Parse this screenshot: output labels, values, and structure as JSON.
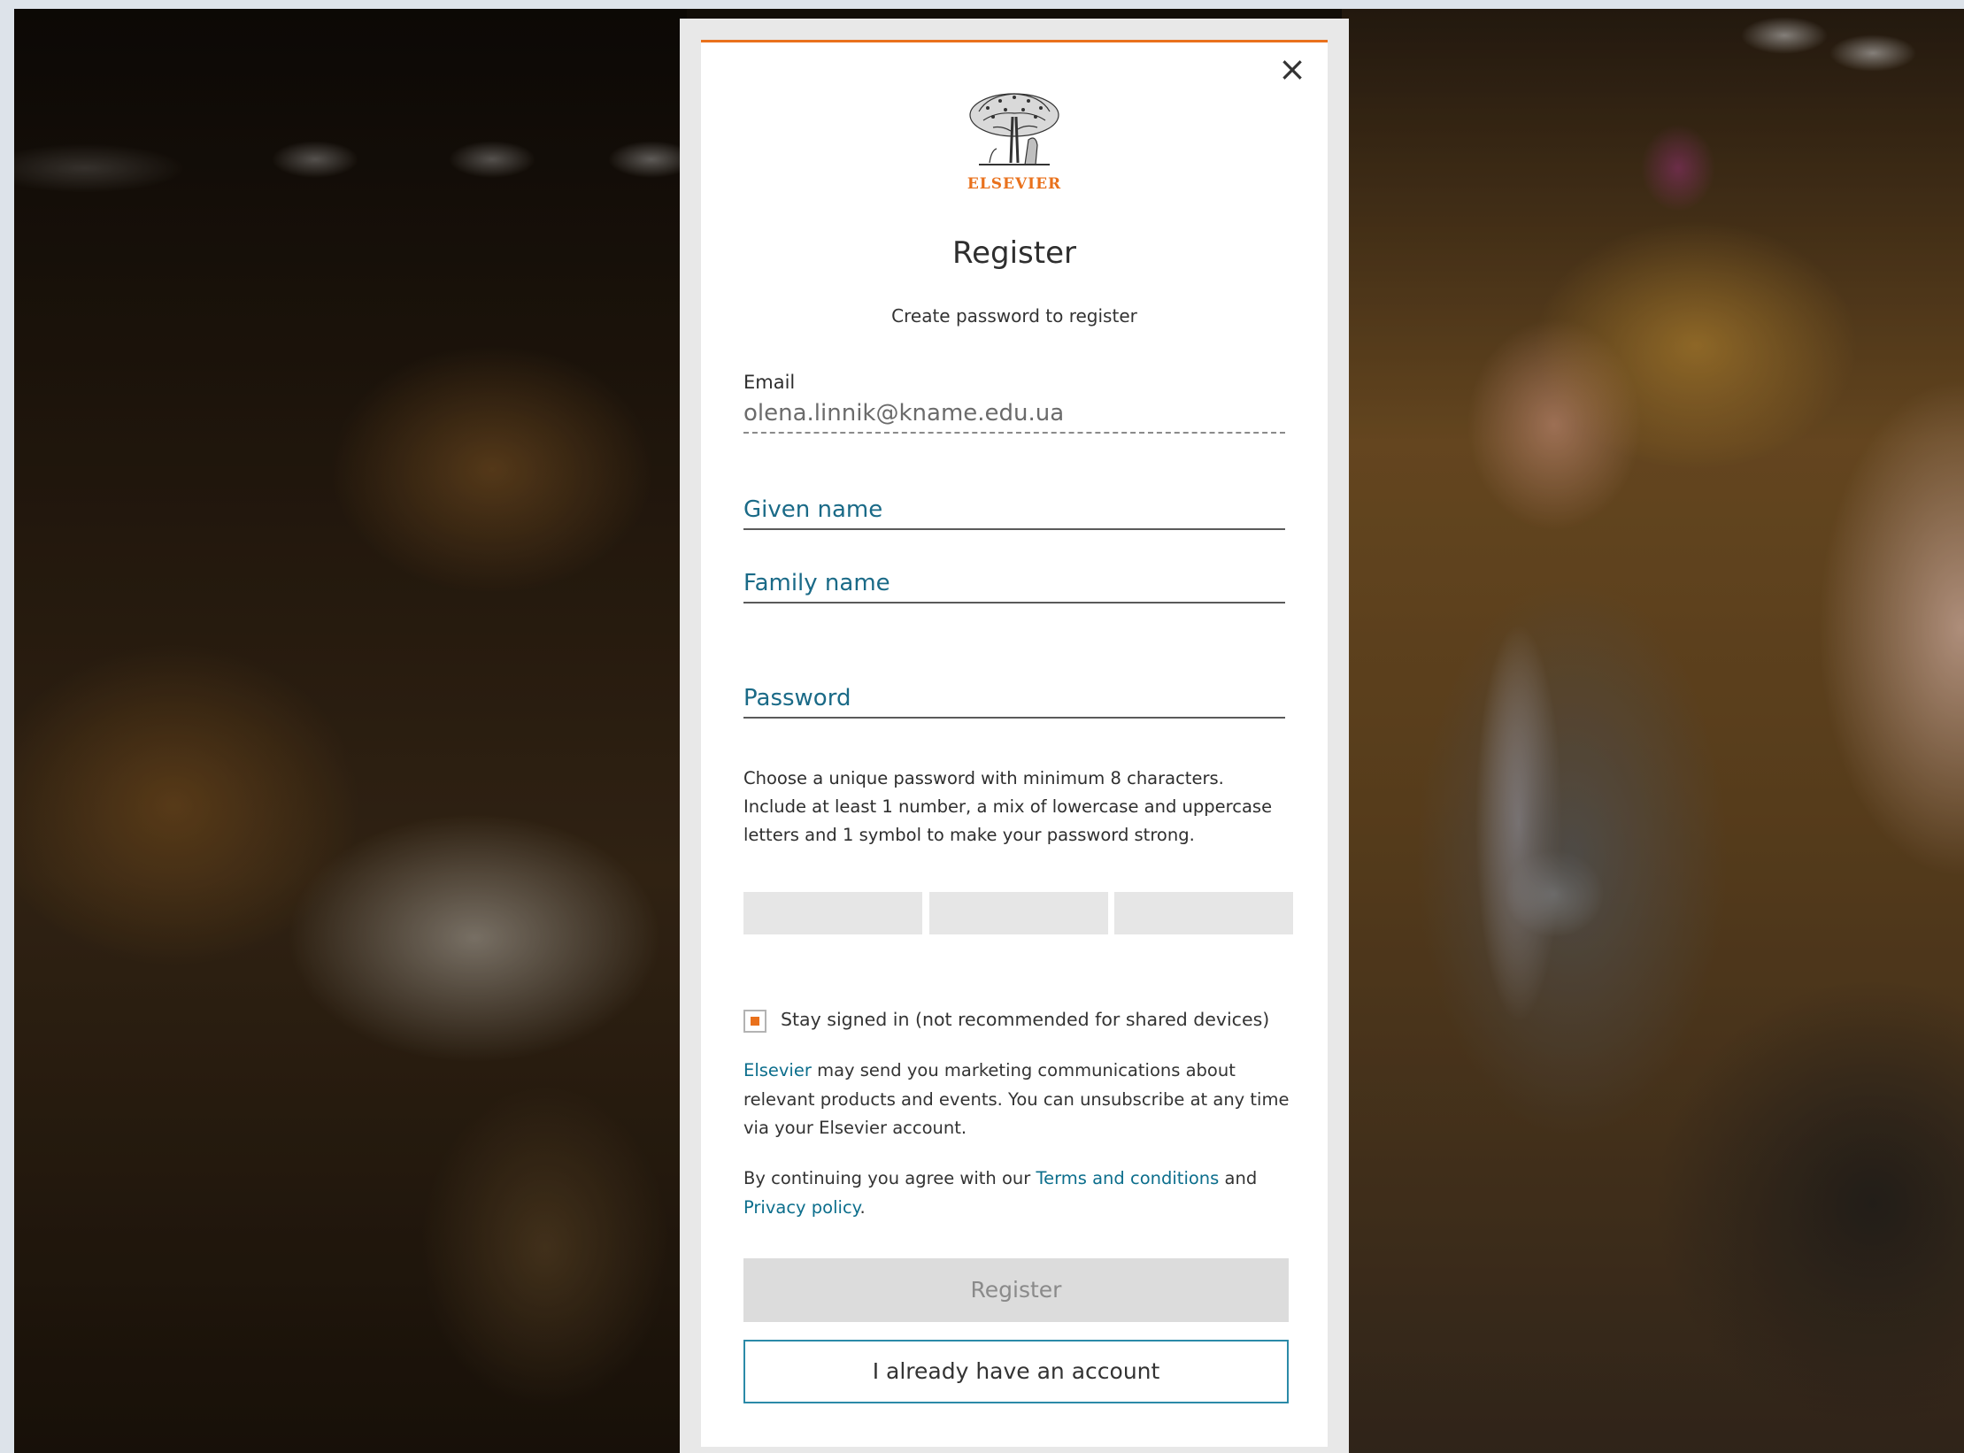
{
  "brand": {
    "logo_text": "ELSEVIER",
    "accent_color": "#e9711c",
    "link_color": "#0c6e8c"
  },
  "header": {
    "title": "Register",
    "subtitle": "Create password to register"
  },
  "form": {
    "email_label": "Email",
    "email_value": "olena.linnik@kname.edu.ua",
    "given_name_placeholder": "Given name",
    "family_name_placeholder": "Family name",
    "password_placeholder": "Password",
    "password_hint": "Choose a unique password with minimum 8 characters. Include at least 1 number, a mix of lowercase and uppercase letters and 1 symbol to make your password strong.",
    "password_strength_segments": 3,
    "stay_signed_in_label": "Stay signed in (not recommended for shared devices)",
    "stay_signed_in_checked": true
  },
  "marketing": {
    "brand_link": "Elsevier",
    "text": " may send you marketing communications about relevant products and events. You can unsubscribe at any time via your Elsevier account."
  },
  "terms": {
    "prefix": "By continuing you agree with our ",
    "terms_link": "Terms and conditions",
    "middle": " and ",
    "privacy_link": "Privacy policy",
    "suffix": "."
  },
  "buttons": {
    "register": "Register",
    "have_account": "I already have an account"
  },
  "icons": {
    "close": "close-icon",
    "logo": "elsevier-tree-logo"
  }
}
